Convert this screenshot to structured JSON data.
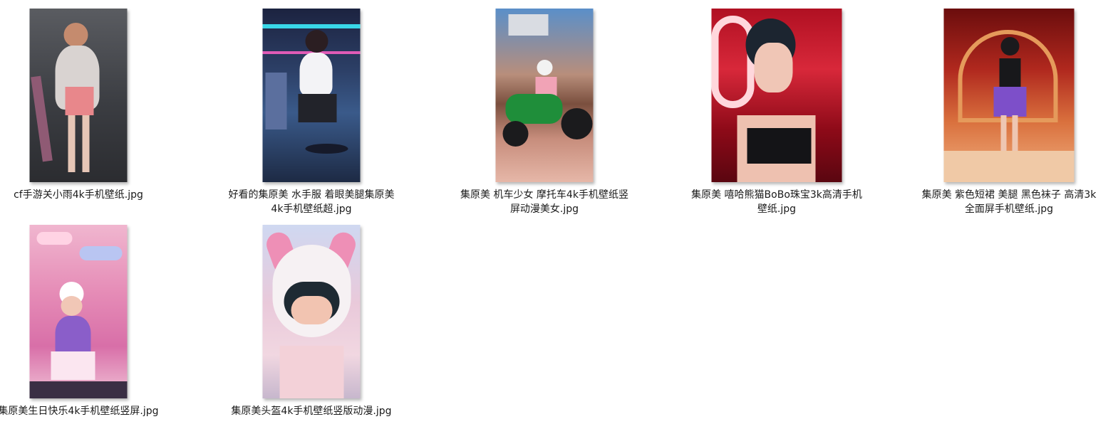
{
  "files": [
    {
      "caption_lines": [
        "cf手游关小雨4k手机壁纸.jpg"
      ],
      "thumb_icon": "image-thumbnail-icon"
    },
    {
      "caption_lines": [
        "好看的集原美 水手服 着眼美腿集原美",
        "4k手机壁纸超.jpg"
      ],
      "thumb_icon": "image-thumbnail-icon"
    },
    {
      "caption_lines": [
        "集原美 机车少女 摩托车4k手机壁纸竖",
        "屏动漫美女.jpg"
      ],
      "thumb_icon": "image-thumbnail-icon"
    },
    {
      "caption_lines": [
        "集原美 嘻哈熊猫BoBo珠宝3k高清手机",
        "壁纸.jpg"
      ],
      "thumb_icon": "image-thumbnail-icon"
    },
    {
      "caption_lines": [
        "集原美 紫色短裙 美腿 黑色袜子 高清3k",
        "全面屏手机壁纸.jpg"
      ],
      "thumb_icon": "image-thumbnail-icon"
    },
    {
      "caption_lines": [
        "集原美生日快乐4k手机壁纸竖屏.jpg"
      ],
      "thumb_icon": "image-thumbnail-icon"
    },
    {
      "caption_lines": [
        "集原美头盔4k手机壁纸竖版动漫.jpg"
      ],
      "thumb_icon": "image-thumbnail-icon"
    }
  ]
}
